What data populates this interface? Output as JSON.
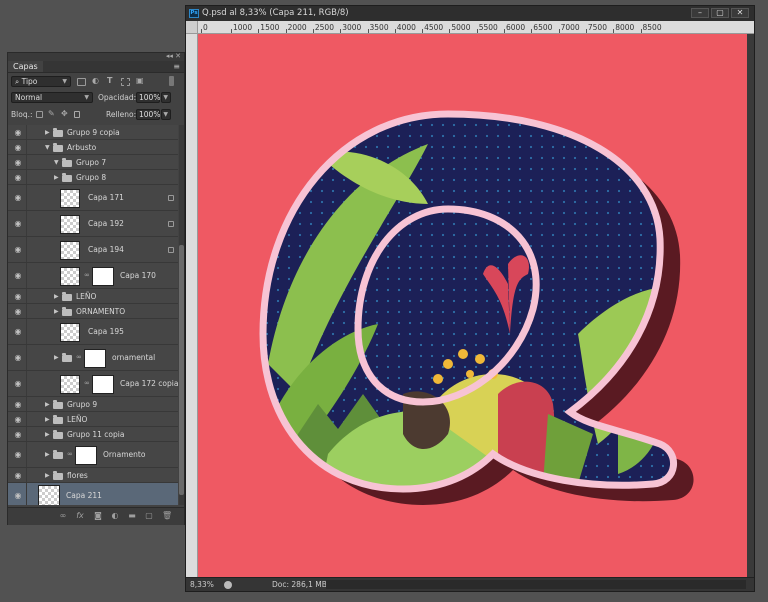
{
  "layers_panel": {
    "tab": "Capas",
    "filter_label": "Tipo",
    "blend_mode": "Normal",
    "opacity_label": "Opacidad:",
    "opacity_value": "100%",
    "lock_label": "Bloq.:",
    "fill_label": "Relleno:",
    "fill_value": "100%",
    "layers": [
      {
        "name": "Grupo 9 copia",
        "kind": "group",
        "indent": 1,
        "expanded": false
      },
      {
        "name": "Arbusto",
        "kind": "group",
        "indent": 1,
        "expanded": true
      },
      {
        "name": "Grupo 7",
        "kind": "group",
        "indent": 2,
        "expanded": true
      },
      {
        "name": "Grupo 8",
        "kind": "group",
        "indent": 2,
        "expanded": false
      },
      {
        "name": "Capa 171",
        "kind": "layer",
        "indent": 2,
        "locked": true
      },
      {
        "name": "Capa 192",
        "kind": "layer",
        "indent": 2,
        "locked": true
      },
      {
        "name": "Capa 194",
        "kind": "layer",
        "indent": 2,
        "locked": true
      },
      {
        "name": "Capa 170",
        "kind": "masked",
        "indent": 2
      },
      {
        "name": "LEÑO",
        "kind": "group",
        "indent": 2,
        "expanded": false
      },
      {
        "name": "ORNAMENTO",
        "kind": "group",
        "indent": 2,
        "expanded": false
      },
      {
        "name": "Capa 195",
        "kind": "layer",
        "indent": 2
      },
      {
        "name": "ornamental",
        "kind": "maskgroup",
        "indent": 2
      },
      {
        "name": "Capa 172 copia",
        "kind": "masked",
        "indent": 2
      },
      {
        "name": "Grupo 9",
        "kind": "group",
        "indent": 1,
        "expanded": false
      },
      {
        "name": "LEÑO",
        "kind": "group",
        "indent": 1,
        "expanded": false
      },
      {
        "name": "Grupo 11 copia",
        "kind": "group",
        "indent": 1,
        "expanded": false
      },
      {
        "name": "Ornamento",
        "kind": "maskgroup",
        "indent": 1
      },
      {
        "name": "flores",
        "kind": "group",
        "indent": 1,
        "expanded": false
      },
      {
        "name": "Capa 211",
        "kind": "layer",
        "indent": 0,
        "active": true
      }
    ]
  },
  "document": {
    "title": "Q.psd al 8,33% (Capa 211, RGB/8)",
    "ruler_ticks": [
      "0",
      "1000",
      "1500",
      "2000",
      "2500",
      "3000",
      "3500",
      "4000",
      "4500",
      "5000",
      "5500",
      "6000",
      "6500",
      "7000",
      "7500",
      "8000",
      "8500"
    ],
    "zoom": "8,33%",
    "doc_info": "Doc: 286,1 MB/1,10 G",
    "canvas_color": "#ef5963",
    "colors": {
      "navy": "#1c2057",
      "outline": "#f7c3d4",
      "shadow": "#5c1a22",
      "leaf": "#8cbf4e"
    }
  }
}
